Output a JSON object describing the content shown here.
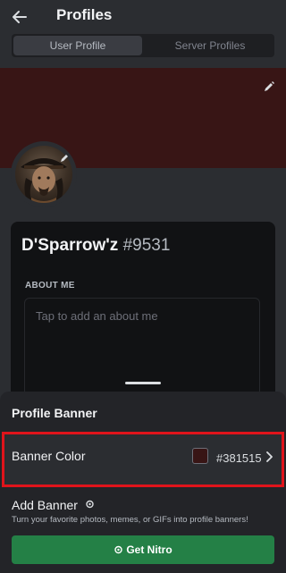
{
  "header": {
    "title": "Profiles",
    "back_icon": "arrow-left-icon"
  },
  "tabs": [
    {
      "label": "User Profile",
      "active": true
    },
    {
      "label": "Server Profiles",
      "active": false
    }
  ],
  "profile": {
    "banner_color": "#381515",
    "display_name": "D'Sparrow'z",
    "discriminator": "#9531",
    "about_me_label": "ABOUT ME",
    "about_me_placeholder": "Tap to add an about me"
  },
  "sheet": {
    "title": "Profile Banner",
    "banner_color_row": {
      "label": "Banner Color",
      "value": "#381515",
      "swatch_color": "#381515",
      "highlight_color": "#e0141b"
    },
    "add_banner": {
      "title": "Add Banner",
      "description": "Turn your favorite photos, memes, or GIFs into profile banners!",
      "button_label": "Get Nitro",
      "button_color": "#248046"
    }
  }
}
